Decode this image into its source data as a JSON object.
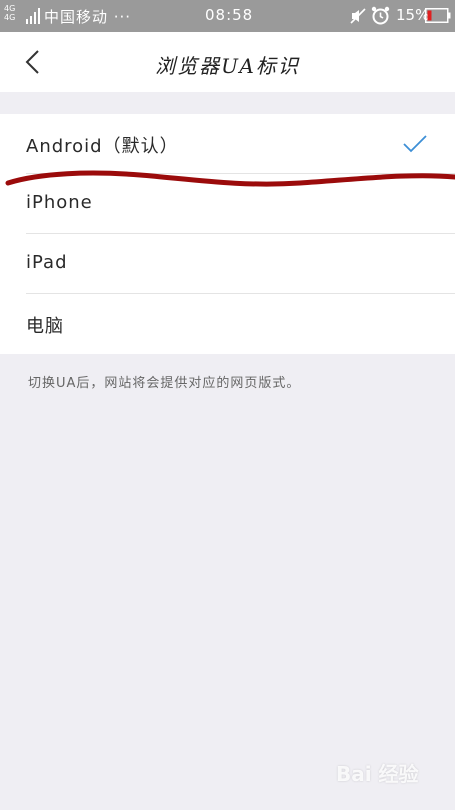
{
  "status_bar": {
    "network": "4G 4G",
    "carrier": "中国移动 ···",
    "time": "08:58",
    "battery": "15%"
  },
  "nav": {
    "title": "浏览器UA标识"
  },
  "options": [
    {
      "label": "Android（默认）",
      "selected": true
    },
    {
      "label": "iPhone",
      "selected": false
    },
    {
      "label": "iPad",
      "selected": false
    },
    {
      "label": "电脑",
      "selected": false
    }
  ],
  "note": "切换UA后，网站将会提供对应的网页版式。",
  "colors": {
    "accent": "#3d8fd6",
    "annotation": "#9b0b0b",
    "status_bar": "#9a9a9a",
    "battery_low": "#e02020"
  },
  "icons": {
    "back": "chevron-left-icon",
    "check": "check-icon",
    "mute": "mute-icon",
    "alarm": "alarm-icon",
    "battery": "battery-icon"
  }
}
